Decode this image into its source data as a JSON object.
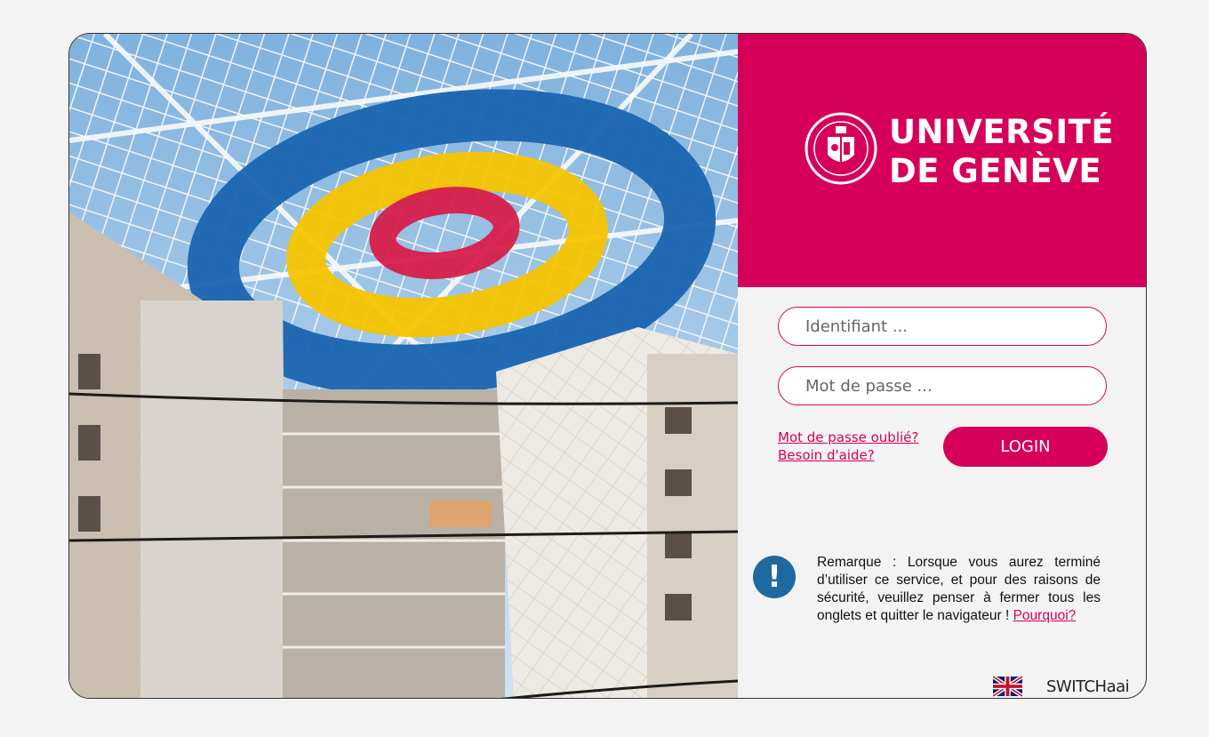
{
  "brand": {
    "name_line1": "UNIVERSITÉ",
    "name_line2": "DE GENÈVE",
    "color": "#d6005a"
  },
  "login_form": {
    "username_placeholder": "Identifiant ...",
    "password_placeholder": "Mot de passe ...",
    "forgot_password_link": "Mot de passe oublié?",
    "help_link": "Besoin d'aide?",
    "login_button": "LOGIN"
  },
  "notice": {
    "icon": "exclamation-icon",
    "text": "Remarque : Lorsque vous aurez terminé d’utiliser ce service, et pour des raisons de sécurité, veuillez penser à fermer tous les onglets et quitter le navigateur !",
    "link": "Pourquoi?"
  },
  "footer": {
    "language_icon": "uk-flag-icon",
    "provider": "SWITCHaai"
  },
  "colors": {
    "accent": "#d6005a",
    "info_blue": "#1e6aa0"
  }
}
